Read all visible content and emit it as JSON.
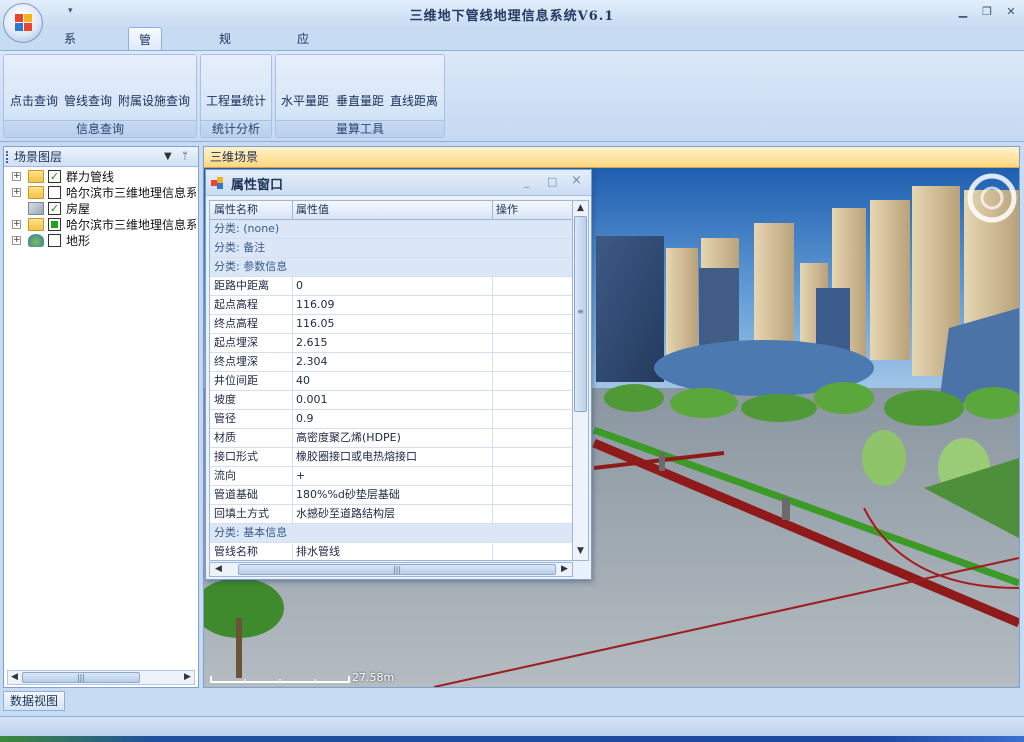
{
  "window": {
    "title": "三维地下管线地理信息系统V6.1",
    "qat_arrow": "▾",
    "minimize": "▁",
    "restore": "❐",
    "close": "✕"
  },
  "ribbon": {
    "tabs": [
      {
        "label": "系统工具",
        "active": false
      },
      {
        "label": "管线管理",
        "active": true
      },
      {
        "label": "规划审批",
        "active": false
      },
      {
        "label": "应急抢险",
        "active": false
      }
    ],
    "groups": [
      {
        "label": "信息查询",
        "buttons": [
          "点击查询",
          "管线查询",
          "附属设施查询"
        ]
      },
      {
        "label": "统计分析",
        "buttons": [
          "工程量统计"
        ]
      },
      {
        "label": "量算工具",
        "buttons": [
          "水平量距",
          "垂直量距",
          "直线距离"
        ]
      }
    ]
  },
  "layers": {
    "title": "场景图层",
    "dropdown_icon": "▼",
    "pin_icon": "ᛘ",
    "items": [
      {
        "label": "群力管线",
        "checked": true,
        "filled": false,
        "icon": "folder"
      },
      {
        "label": "哈尔滨市三维地理信息系",
        "checked": false,
        "filled": false,
        "icon": "folder"
      },
      {
        "label": "房屋",
        "checked": true,
        "filled": false,
        "icon": "model"
      },
      {
        "label": "哈尔滨市三维地理信息系",
        "checked": false,
        "filled": true,
        "icon": "folder"
      },
      {
        "label": "地形",
        "checked": false,
        "filled": false,
        "icon": "terrain"
      }
    ],
    "scroll_left": "◀",
    "scroll_right": "▶",
    "scroll_grip": "|||"
  },
  "scene": {
    "title": "三维场景",
    "scale_text": "27.58m"
  },
  "attribute_window": {
    "title": "属性窗口",
    "min": "_",
    "max": "□",
    "close": "×",
    "columns": [
      "属性名称",
      "属性值",
      "操作"
    ],
    "rows": [
      {
        "type": "cat",
        "name": "分类: (none)"
      },
      {
        "type": "cat",
        "name": "分类: 备注"
      },
      {
        "type": "cat",
        "name": "分类: 参数信息"
      },
      {
        "type": "row",
        "name": "距路中距离",
        "value": "0"
      },
      {
        "type": "row",
        "name": "起点高程",
        "value": "116.09"
      },
      {
        "type": "row",
        "name": "终点高程",
        "value": "116.05"
      },
      {
        "type": "row",
        "name": "起点埋深",
        "value": "2.615"
      },
      {
        "type": "row",
        "name": "终点埋深",
        "value": "2.304"
      },
      {
        "type": "row",
        "name": "井位间距",
        "value": "40"
      },
      {
        "type": "row",
        "name": "坡度",
        "value": "0.001"
      },
      {
        "type": "row",
        "name": "管径",
        "value": "0.9"
      },
      {
        "type": "row",
        "name": "材质",
        "value": "高密度聚乙烯(HDPE)"
      },
      {
        "type": "row",
        "name": "接口形式",
        "value": "橡胶圈接口或电热熔接口"
      },
      {
        "type": "row",
        "name": "流向",
        "value": "+"
      },
      {
        "type": "row",
        "name": "管道基础",
        "value": "180%%d砂垫层基础"
      },
      {
        "type": "row",
        "name": "回填土方式",
        "value": "水撼砂至道路结构层"
      },
      {
        "type": "cat",
        "name": "分类: 基本信息"
      },
      {
        "type": "row",
        "name": "管线名称",
        "value": "排水管线"
      }
    ],
    "scroll_up": "▲",
    "scroll_down": "▼",
    "scroll_left": "◀",
    "scroll_right": "▶",
    "grip": "|||"
  },
  "bottom": {
    "tab": "数据视图"
  },
  "colors": {
    "ribbon": "#d6e5f7",
    "scene_header": "#ffd780",
    "pipe_red": "#8f1a1a",
    "pipe_green": "#3c9a26"
  }
}
